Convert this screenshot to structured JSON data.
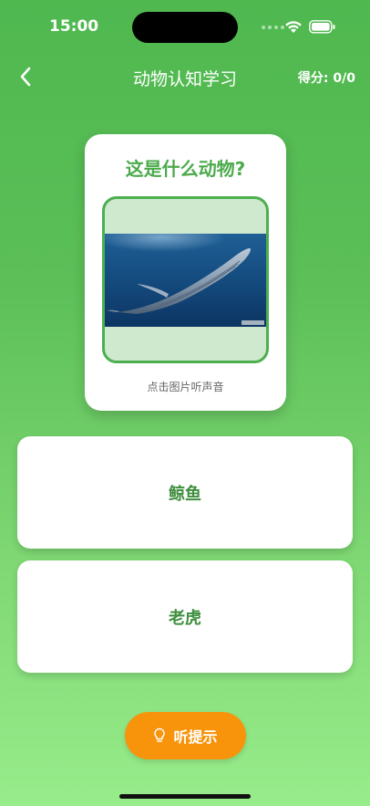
{
  "status": {
    "time": "15:00"
  },
  "header": {
    "title": "动物认知学习",
    "score": "得分: 0/0"
  },
  "question": {
    "prompt": "这是什么动物?",
    "image_icon": "blue-whale-photo",
    "image_hint": "点击图片听声音"
  },
  "options": [
    {
      "label": "鲸鱼"
    },
    {
      "label": "老虎"
    }
  ],
  "hint_button": {
    "label": "听提示",
    "icon": "lightbulb-icon"
  },
  "colors": {
    "accent_green": "#4caa4c",
    "hint_orange": "#f7940c"
  }
}
